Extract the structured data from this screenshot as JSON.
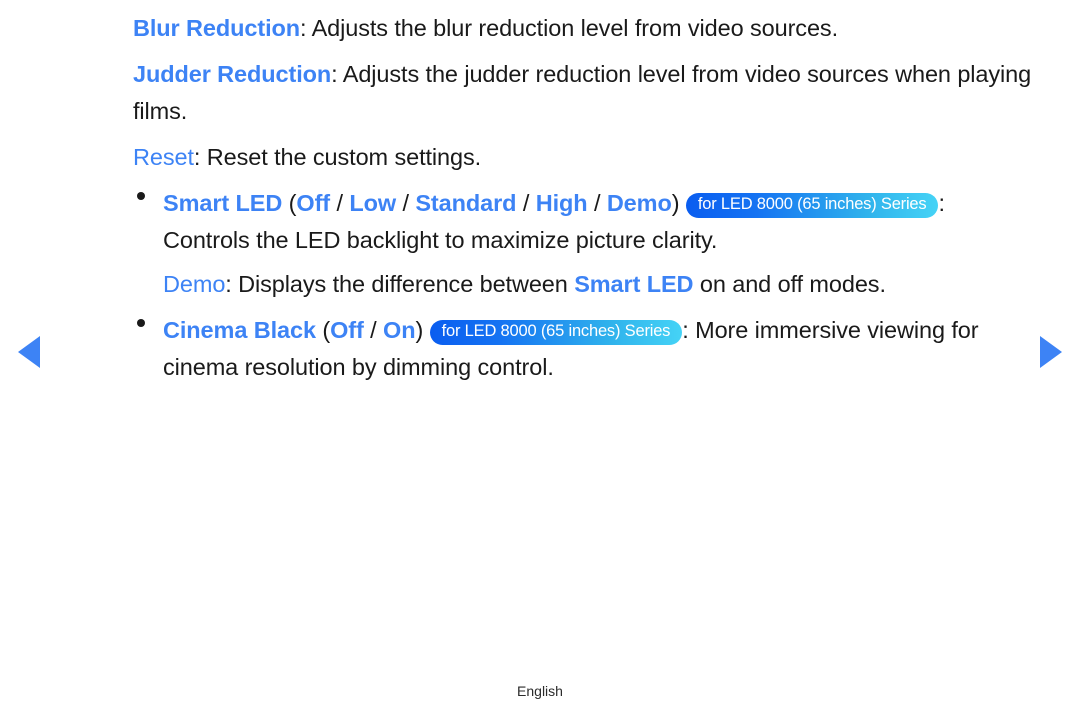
{
  "page": {
    "language_label": "English",
    "accent_color": "#3d83f5",
    "text_color": "#1a1a1a",
    "badge_gradient_from": "#0a5df0",
    "badge_gradient_to": "#45d3f6"
  },
  "nav": {
    "prev_label": "◀",
    "next_label": "▶"
  },
  "badge": {
    "text": "for LED 8000 (65 inches) Series"
  },
  "entries": {
    "blur_reduction": {
      "term": "Blur Reduction",
      "colon": ":",
      "description": " Adjusts the blur reduction level from video sources."
    },
    "judder_reduction": {
      "term": "Judder Reduction",
      "colon": ":",
      "description": " Adjusts the judder reduction level from video sources when",
      "description_line2": "playing films."
    },
    "reset": {
      "term": "Reset",
      "colon": ":",
      "description": " Reset the custom settings."
    },
    "smart_led": {
      "term": "Smart LED",
      "open_paren": " (",
      "options": [
        "Off",
        "Low",
        "Standard",
        "High",
        "Demo"
      ],
      "separator": " / ",
      "close_paren": ")",
      "colon": ":",
      "description_line2": "Controls the LED backlight to maximize picture clarity."
    },
    "demo": {
      "term": "Demo",
      "colon": ":",
      "description_part1": " Displays the difference between ",
      "inline_term": "Smart LED",
      "description_part2": " on and off modes."
    },
    "cinema_black": {
      "term": "Cinema Black",
      "open_paren": " (",
      "options": [
        "Off",
        "On"
      ],
      "separator": " / ",
      "close_paren": ")",
      "colon": ":",
      "description": " More immersive viewing for",
      "description_line2": "cinema resolution by dimming control."
    }
  }
}
